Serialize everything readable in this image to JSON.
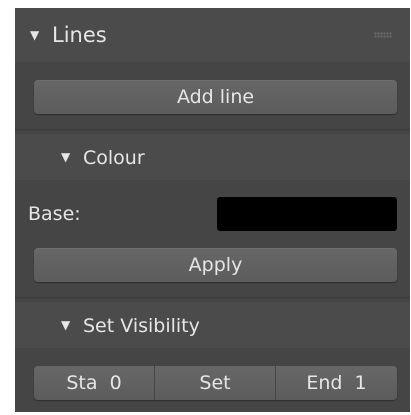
{
  "panel": {
    "title": "Lines",
    "add_line_label": "Add line",
    "colour": {
      "title": "Colour",
      "base_label": "Base:",
      "base_color": "#000000",
      "apply_label": "Apply"
    },
    "visibility": {
      "title": "Set Visibility",
      "start_label": "Sta",
      "start_value": "0",
      "set_label": "Set",
      "end_label": "End",
      "end_value": "1"
    }
  },
  "colors": {
    "panel_bg": "#454545",
    "header_bg": "#4b4b4b",
    "button_bg": "#616161",
    "text": "#e6e6e6"
  }
}
